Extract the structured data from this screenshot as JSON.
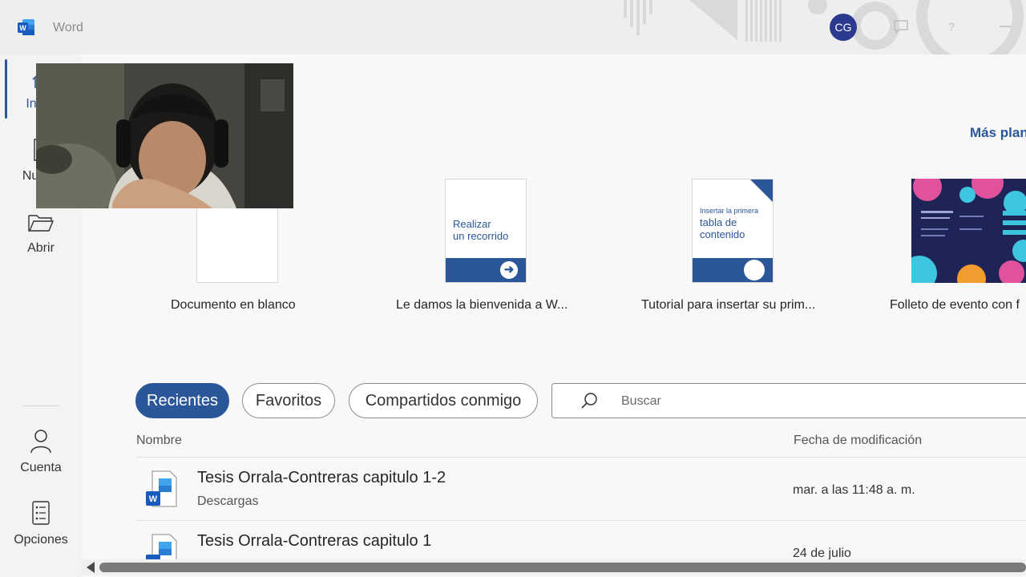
{
  "titlebar": {
    "app_name": "Word",
    "avatar_initials": "CG"
  },
  "sidebar": {
    "items": [
      {
        "label": "Inicio",
        "icon": "home-icon"
      },
      {
        "label": "Nuevo",
        "icon": "new-document-icon"
      },
      {
        "label": "Abrir",
        "icon": "folder-open-icon"
      }
    ],
    "bottom": [
      {
        "label": "Cuenta",
        "icon": "person-icon"
      },
      {
        "label": "Opciones",
        "icon": "options-icon"
      }
    ]
  },
  "templates": {
    "more_label": "Más plant",
    "items": [
      {
        "caption": "Documento en blanco"
      },
      {
        "caption": "Le damos la bienvenida a W...",
        "thumb_line1": "Realizar",
        "thumb_line2": "un recorrido"
      },
      {
        "caption": "Tutorial para insertar su prim...",
        "thumb_small": "Insertar la primera",
        "thumb_line1": "tabla de",
        "thumb_line2": "contenido"
      },
      {
        "caption": "Folleto de evento con f"
      }
    ]
  },
  "tabs": {
    "recent": "Recientes",
    "favorites": "Favoritos",
    "shared": "Compartidos conmigo"
  },
  "search": {
    "placeholder": "Buscar"
  },
  "list": {
    "col_name": "Nombre",
    "col_date": "Fecha de modificación",
    "rows": [
      {
        "name": "Tesis Orrala-Contreras capitulo 1-2",
        "location": "Descargas",
        "date": "mar. a las 11:48 a. m."
      },
      {
        "name": "Tesis Orrala-Contreras capitulo 1",
        "location": "",
        "date": "24 de julio"
      }
    ]
  },
  "colors": {
    "accent": "#2b579a",
    "avatar": "#2b3a8f"
  }
}
